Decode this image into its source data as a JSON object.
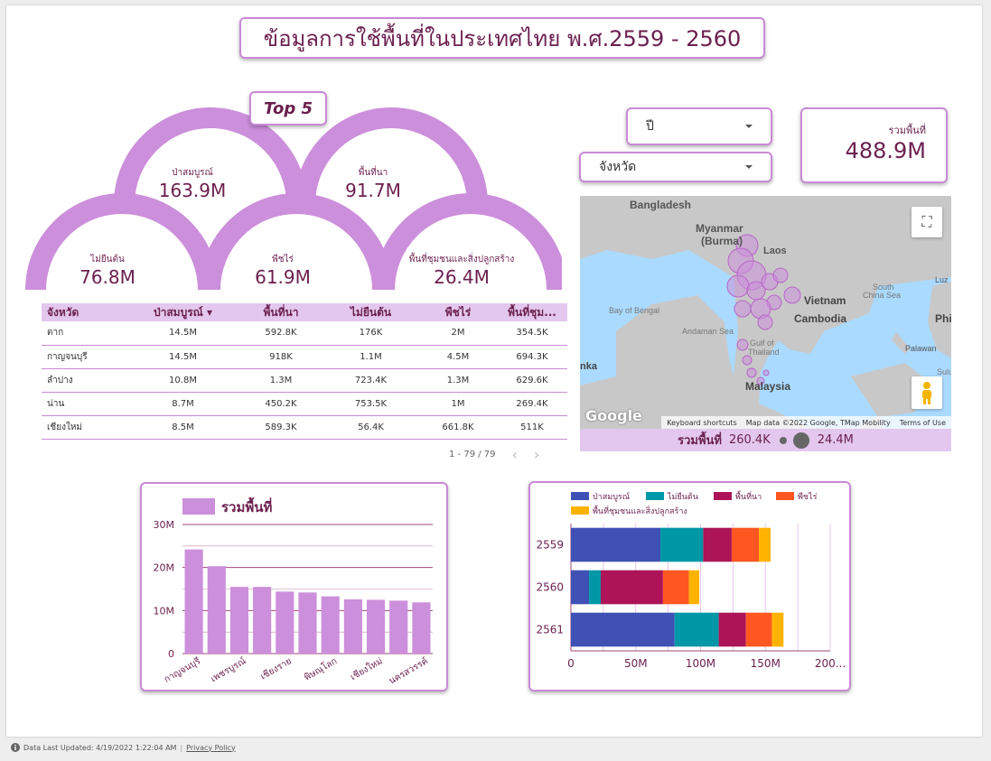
{
  "title": "ข้อมูลการใช้พื้นที่ในประเทศไทย พ.ศ.2559 -  2560",
  "top5_label": "Top 5",
  "gauges": [
    {
      "label": "ป่าสมบูรณ์",
      "value": "163.9M"
    },
    {
      "label": "พื้นที่นา",
      "value": "91.7M"
    },
    {
      "label": "ไม่ยืนต้น",
      "value": "76.8M"
    },
    {
      "label": "พืชไร่",
      "value": "61.9M"
    },
    {
      "label": "พื้นที่ชุมชนและสิ่งปลูกสร้าง",
      "value": "26.4M"
    }
  ],
  "filters": {
    "year": "ปี",
    "province": "จังหวัด"
  },
  "total": {
    "label": "รวมพื้นที่",
    "value": "488.9M"
  },
  "table": {
    "headers": [
      "จังหวัด",
      "ป่าสมบูรณ์ ▾",
      "พื้นที่นา",
      "ไม่ยืนต้น",
      "พืชไร่",
      "พื้นที่ชุม..."
    ],
    "rows": [
      [
        "ตาก",
        "14.5M",
        "592.8K",
        "176K",
        "2M",
        "354.5K"
      ],
      [
        "กาญจนบุรี",
        "14.5M",
        "918K",
        "1.1M",
        "4.5M",
        "694.3K"
      ],
      [
        "ลำปาง",
        "10.8M",
        "1.3M",
        "723.4K",
        "1.3M",
        "629.6K"
      ],
      [
        "น่าน",
        "8.7M",
        "450.2K",
        "753.5K",
        "1M",
        "269.4K"
      ],
      [
        "เชียงใหม่",
        "8.5M",
        "589.3K",
        "56.4K",
        "661.8K",
        "511K"
      ]
    ],
    "pagination": "1 - 79 / 79"
  },
  "map": {
    "labels": [
      "Bangladesh",
      "Myanmar",
      "(Burma)",
      "Laos",
      "Vietnam",
      "Cambodia",
      "South",
      "China Sea",
      "Bay of Bengal",
      "Andaman Sea",
      "Gulf of",
      "Thailand",
      "Malaysia",
      "Palawan",
      "Phi",
      "Luz",
      "nka",
      "Sulu"
    ],
    "attribution": {
      "shortcuts": "Keyboard shortcuts",
      "mapdata": "Map data ©2022 Google, TMap Mobility",
      "terms": "Terms of Use"
    },
    "google": "Google",
    "legend": {
      "label": "รวมพื้นที่",
      "min": "260.4K",
      "max": "24.4M"
    }
  },
  "chart_data": [
    {
      "type": "bar",
      "legend": "รวมพื้นที่",
      "categories": [
        "กาญจนบุรี",
        "",
        "เพชรบูรณ์",
        "",
        "เชียงราย",
        "",
        "พิษณุโลก",
        "",
        "เชียงใหม่",
        "",
        "นครสวรรค์"
      ],
      "values": [
        24.2,
        20.3,
        15.5,
        15.5,
        14.4,
        14.2,
        13.3,
        12.6,
        12.5,
        12.3,
        11.9
      ],
      "ylim": [
        0,
        30
      ],
      "yticks": [
        "0",
        "10M",
        "20M",
        "30M"
      ]
    },
    {
      "type": "bar",
      "orientation": "horizontal",
      "stacked": true,
      "categories": [
        "2559",
        "2560",
        "2561"
      ],
      "series": [
        {
          "name": "ป่าสมบูรณ์",
          "color": "#3f51b5",
          "values": [
            69,
            14,
            80
          ]
        },
        {
          "name": "ไม่ยืนต้น",
          "color": "#0097a7",
          "values": [
            33,
            9,
            34
          ]
        },
        {
          "name": "พื้นที่นา",
          "color": "#ad1457",
          "values": [
            22,
            48,
            21
          ]
        },
        {
          "name": "พืชไร่",
          "color": "#ff5722",
          "values": [
            21,
            20,
            20
          ]
        },
        {
          "name": "พื้นที่ชุมชนและสิ่งปลูกสร้าง",
          "color": "#ffb300",
          "values": [
            9,
            8,
            9
          ]
        }
      ],
      "xlim": [
        0,
        200
      ],
      "xticks": [
        "0",
        "50M",
        "100M",
        "150M",
        "200..."
      ]
    }
  ],
  "footer": {
    "updated": "Data Last Updated: 4/19/2022 1:22:04 AM",
    "privacy": "Privacy Policy"
  }
}
